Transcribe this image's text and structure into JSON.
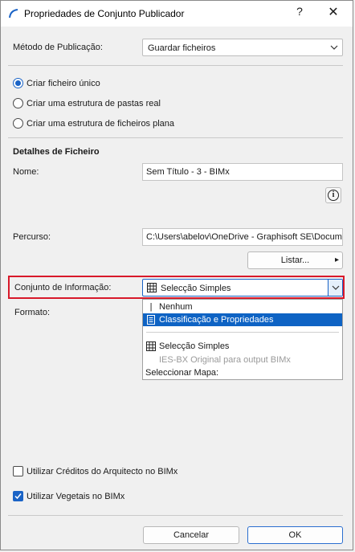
{
  "window": {
    "title": "Propriedades de Conjunto Publicador",
    "help_label": "?",
    "close_label": "✕"
  },
  "publish_method": {
    "label": "Método de Publicação:",
    "value": "Guardar ficheiros"
  },
  "structure_options": [
    {
      "label": "Criar ficheiro único",
      "selected": true
    },
    {
      "label": "Criar uma estrutura de pastas real",
      "selected": false
    },
    {
      "label": "Criar uma estrutura de ficheiros plana",
      "selected": false
    }
  ],
  "file_details": {
    "heading": "Detalhes de Ficheiro",
    "name_label": "Nome:",
    "name_value": "Sem Título - 3 - BIMx",
    "info_label": "i",
    "path_label": "Percurso:",
    "path_value": "C:\\Users\\abelov\\OneDrive - Graphisoft SE\\Documents",
    "list_button": "Listar...",
    "list_arrow": "▸"
  },
  "info_set": {
    "label": "Conjunto de Informação:",
    "value": "Selecção Simples",
    "format_label": "Formato:"
  },
  "dropdown": {
    "items": [
      {
        "label": "Nenhum",
        "icon": "cursor-icon",
        "selected": false
      },
      {
        "label": "Classificação e Propriedades",
        "icon": "document-icon",
        "selected": true
      },
      {
        "label": "Selecção Simples",
        "icon": "table-icon",
        "selected": false
      },
      {
        "label": "IES-BX Original para output BIMx",
        "icon": "",
        "selected": false,
        "muted": true
      },
      {
        "label": "Seleccionar Mapa:",
        "icon": "",
        "selected": false
      }
    ]
  },
  "checkboxes": [
    {
      "label": "Utilizar Créditos do Arquitecto no BIMx",
      "checked": false
    },
    {
      "label": "Utilizar Vegetais no BIMx",
      "checked": true
    }
  ],
  "footer": {
    "cancel_label": "Cancelar",
    "ok_label": "OK"
  },
  "colors": {
    "accent": "#1a63c6",
    "highlight_border": "#d8192a",
    "selection": "#0e63c4"
  }
}
